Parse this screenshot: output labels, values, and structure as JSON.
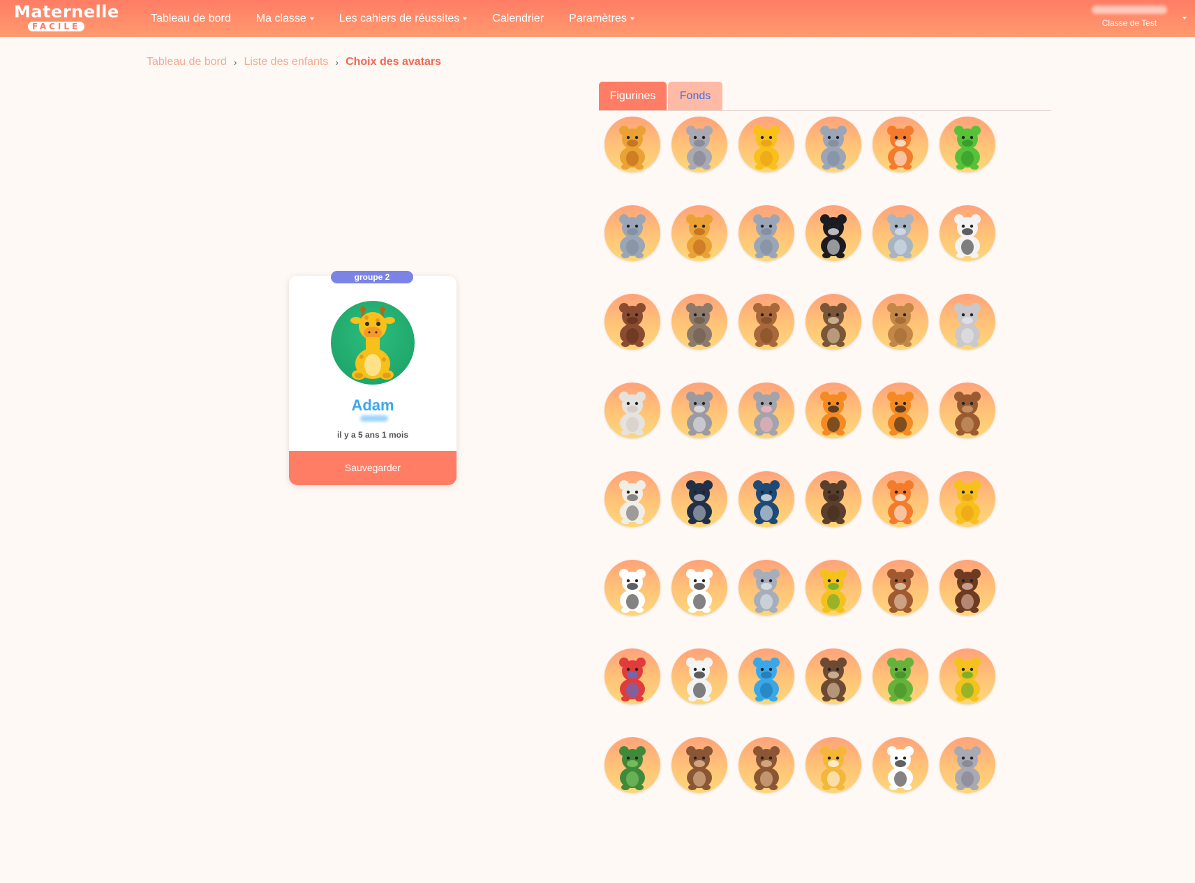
{
  "app": {
    "logo_top": "Maternelle",
    "logo_bottom": "FACILE"
  },
  "nav": {
    "items": [
      {
        "label": "Tableau de bord",
        "dropdown": false
      },
      {
        "label": "Ma classe",
        "dropdown": true
      },
      {
        "label": "Les cahiers de réussites",
        "dropdown": true
      },
      {
        "label": "Calendrier",
        "dropdown": false
      },
      {
        "label": "Paramètres",
        "dropdown": true
      }
    ]
  },
  "user": {
    "class_name": "Classe de Test"
  },
  "breadcrumb": {
    "items": [
      "Tableau de bord",
      "Liste des enfants"
    ],
    "current": "Choix des avatars"
  },
  "child_card": {
    "group": "groupe 2",
    "name": "Adam",
    "age": "il y a 5 ans 1 mois",
    "save_label": "Sauvegarder",
    "avatar_icon": "giraffe-icon"
  },
  "tabs": {
    "figurines": "Figurines",
    "fonds": "Fonds"
  },
  "colors": {
    "header": "#ff7d65",
    "accent": "#ff7d65",
    "group_badge": "#7b84e6",
    "name": "#3aa8f0",
    "avatar_bg": "#1fa96c"
  },
  "avatars": [
    "lion-icon",
    "hippo-icon",
    "giraffe-icon",
    "elephant-icon",
    "fox-icon",
    "frog-icon",
    "elephant-icon",
    "lion-icon",
    "elephant-icon",
    "orca-icon",
    "narwhal-icon",
    "zebra-icon",
    "boar-icon",
    "walrus-icon",
    "capybara-icon",
    "otter-icon",
    "camel-icon",
    "koala-icon",
    "seal-icon",
    "ferret-icon",
    "mouse-icon",
    "tiger-icon",
    "tiger-icon",
    "squirrel-icon",
    "sheep-icon",
    "tapir-icon",
    "whale-icon",
    "bear-icon",
    "fox-icon",
    "giraffe-icon",
    "cow-icon",
    "panda-icon",
    "rabbit-icon",
    "snake-icon",
    "deer-icon",
    "vulture-icon",
    "parrot-icon",
    "zebra-icon",
    "jellyfish-icon",
    "hedgehog-icon",
    "iguana-icon",
    "snake-icon",
    "turtle-icon",
    "monkey-icon",
    "monkey-icon",
    "cat-icon",
    "panda-icon",
    "hippo-icon"
  ]
}
